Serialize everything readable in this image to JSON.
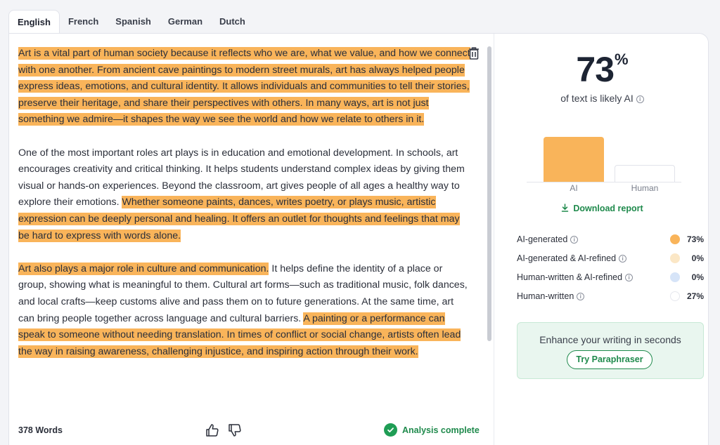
{
  "tabs": [
    "English",
    "French",
    "Spanish",
    "German",
    "Dutch"
  ],
  "editor": {
    "paragraphs": [
      [
        {
          "text": "Art is a vital part of human society because it reflects who we are, what we value, and how we connect with one another. From ancient cave paintings to modern street murals, art has always helped people express ideas, emotions, and cultural identity. It allows individuals and communities to tell their stories, preserve their heritage, and share their perspectives with others. In many ways, art is not just something we admire—it shapes the way we see the world and how we relate to others in it.",
          "ai": true
        }
      ],
      [
        {
          "text": "One of the most important roles art plays is in education and emotional development. In schools, art encourages creativity and critical thinking. It helps students understand complex ideas by giving them visual or hands-on experiences. Beyond the classroom, art gives people of all ages a healthy way to explore their emotions. ",
          "ai": false
        },
        {
          "text": "Whether someone paints, dances, writes poetry, or plays music, artistic expression can be deeply personal and healing. It offers an outlet for thoughts and feelings that may be hard to express with words alone.",
          "ai": true
        }
      ],
      [
        {
          "text": "Art also plays a major role in culture and communication.",
          "ai": true
        },
        {
          "text": " It helps define the identity of a place or group, showing what is meaningful to them. Cultural art forms—such as traditional music, folk dances, and local crafts—keep customs alive and pass them on to future generations. At the same time, art can bring people together across language and cultural barriers. ",
          "ai": false
        },
        {
          "text": "A painting or a performance can speak to someone without needing translation. In times of conflict or social change, artists often lead the way in raising awareness, challenging injustice, and inspiring action through their work.",
          "ai": true
        }
      ]
    ],
    "word_count": "378 Words",
    "status": "Analysis complete"
  },
  "results": {
    "percent": "73",
    "percent_sign": "%",
    "likely_text": "of text is likely AI",
    "chart_data": {
      "type": "bar",
      "categories": [
        "AI",
        "Human"
      ],
      "values": [
        73,
        27
      ],
      "ylim": [
        0,
        100
      ]
    },
    "download_label": "Download report",
    "legend": [
      {
        "label": "AI-generated",
        "value": "73%",
        "color": "#f9b45a"
      },
      {
        "label": "AI-generated & AI-refined",
        "value": "0%",
        "color": "#fbe7c6"
      },
      {
        "label": "Human-written & AI-refined",
        "value": "0%",
        "color": "#d6e4f8"
      },
      {
        "label": "Human-written",
        "value": "27%",
        "color": "#ffffff"
      }
    ],
    "promo_text": "Enhance your writing in seconds",
    "promo_button": "Try Paraphraser"
  }
}
